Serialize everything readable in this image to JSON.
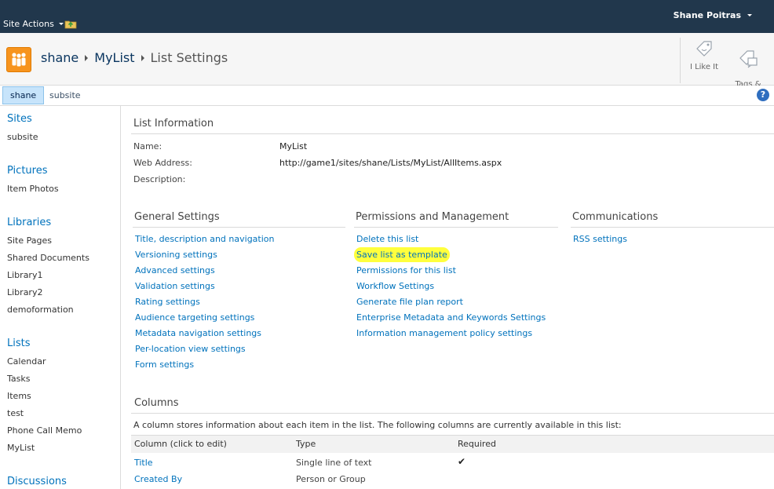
{
  "ribbon": {
    "site_actions": "Site Actions",
    "user": "Shane Poitras"
  },
  "titlebar": {
    "breadcrumb": [
      "shane",
      "MyList",
      "List Settings"
    ],
    "i_like_it": "I Like It",
    "tags_notes": "Tags &\nNotes"
  },
  "topnav": {
    "tabs": [
      "shane",
      "subsite"
    ],
    "help": "?"
  },
  "quicklaunch": {
    "sites": {
      "heading": "Sites",
      "items": [
        "subsite"
      ]
    },
    "pictures": {
      "heading": "Pictures",
      "items": [
        "Item Photos"
      ]
    },
    "libraries": {
      "heading": "Libraries",
      "items": [
        "Site Pages",
        "Shared Documents",
        "Library1",
        "Library2",
        "demoformation"
      ]
    },
    "lists": {
      "heading": "Lists",
      "items": [
        "Calendar",
        "Tasks",
        "Items",
        "test",
        "Phone Call Memo",
        "MyList"
      ]
    },
    "discussions": {
      "heading": "Discussions"
    }
  },
  "list_information": {
    "title": "List Information",
    "name_label": "Name:",
    "name_value": "MyList",
    "web_label": "Web Address:",
    "web_value": "http://game1/sites/shane/Lists/MyList/AllItems.aspx",
    "desc_label": "Description:"
  },
  "general_settings": {
    "title": "General Settings",
    "links": [
      "Title, description and navigation",
      "Versioning settings",
      "Advanced settings",
      "Validation settings",
      "Rating settings",
      "Audience targeting settings",
      "Metadata navigation settings",
      "Per-location view settings",
      "Form settings"
    ]
  },
  "permissions": {
    "title": "Permissions and Management",
    "links": [
      "Delete this list",
      "Save list as template",
      "Permissions for this list",
      "Workflow Settings",
      "Generate file plan report",
      "Enterprise Metadata and Keywords Settings",
      "Information management policy settings"
    ]
  },
  "communications": {
    "title": "Communications",
    "links": [
      "RSS settings"
    ]
  },
  "columns": {
    "title": "Columns",
    "description": "A column stores information about each item in the list. The following columns are currently available in this list:",
    "headers": [
      "Column (click to edit)",
      "Type",
      "Required"
    ],
    "rows": [
      {
        "name": "Title",
        "type": "Single line of text",
        "required": "✔"
      },
      {
        "name": "Created By",
        "type": "Person or Group",
        "required": ""
      }
    ]
  },
  "colors": {
    "ribbon": "#21374c",
    "link": "#0072bc",
    "highlight": "#ffff3d",
    "logo": "#f7941e"
  }
}
